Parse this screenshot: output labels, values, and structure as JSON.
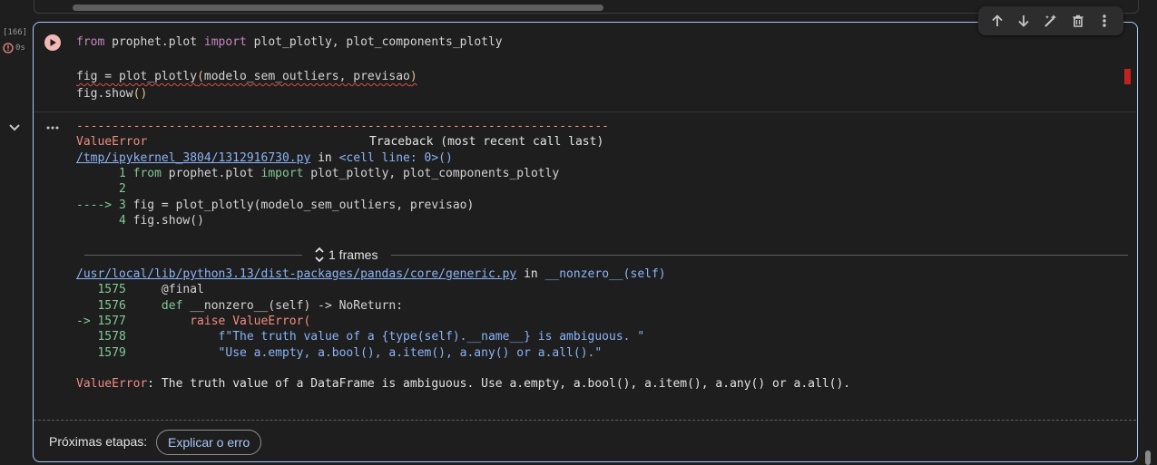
{
  "cell": {
    "execution_count": "[166]",
    "exec_time": "0s",
    "code_lines": {
      "line1": {
        "kw1": "from",
        "mod": " prophet.plot ",
        "kw2": "import",
        "rest": " plot_plotly, plot_components_plotly"
      },
      "line3": {
        "a": "fig = ",
        "fn": "plot_plotly",
        "lp": "(",
        "args": "modelo_sem_outliers, previsao",
        "rp": ")"
      },
      "line4": {
        "a": "fig.show",
        "parens": "()"
      }
    }
  },
  "toolbar": {
    "icons": [
      "arrow-up-icon",
      "arrow-down-icon",
      "edit-wand-icon",
      "delete-icon",
      "more-vert-icon"
    ]
  },
  "output": {
    "dashes": "---------------------------------------------------------------------------",
    "error_name": "ValueError",
    "traceback_header": "Traceback (most recent call last)",
    "tb1": {
      "file_link": "/tmp/ipykernel_3804/1312916730.py",
      "in": " in ",
      "where": "<cell line: 0>()",
      "lines": [
        {
          "num": "      1 ",
          "kw1": "from",
          "mid": " prophet.plot ",
          "kw2": "import",
          "rest": " plot_plotly, plot_components_plotly"
        },
        {
          "num": "      2",
          "text": ""
        },
        {
          "arrow": "----> 3 ",
          "text": "fig = plot_plotly(modelo_sem_outliers, previsao)"
        },
        {
          "num": "      4 ",
          "text": "fig.show()"
        }
      ]
    },
    "frames_label": "1 frames",
    "tb2": {
      "file_link": "/usr/local/lib/python3.13/dist-packages/pandas/core/generic.py",
      "in": " in ",
      "where": "__nonzero__(self)",
      "lines": [
        {
          "num": "   1575     ",
          "text": "@final"
        },
        {
          "num": "   1576     ",
          "kw": "def",
          "text": " __nonzero__(self) -> NoReturn:"
        },
        {
          "num": "-> 1577         ",
          "text": "raise ValueError("
        },
        {
          "num": "   1578             ",
          "text": "f\"The truth value of a {type(self).__name__} is ambiguous. \""
        },
        {
          "num": "   1579             ",
          "text": "\"Use a.empty, a.bool(), a.item(), a.any() or a.all().\""
        }
      ]
    },
    "final_error_name": "ValueError",
    "final_error_msg": ": The truth value of a DataFrame is ambiguous. Use a.empty, a.bool(), a.item(), a.any() or a.all()."
  },
  "footer": {
    "next_steps_label": "Próximas etapas:",
    "explain_button": "Explicar o erro"
  },
  "colors": {
    "cell_border": "#a8c7fa",
    "error_red": "#f28b82",
    "line_num_green": "#81c995",
    "link_blue": "#8ab4f8",
    "run_button": "#f2b8b5"
  }
}
